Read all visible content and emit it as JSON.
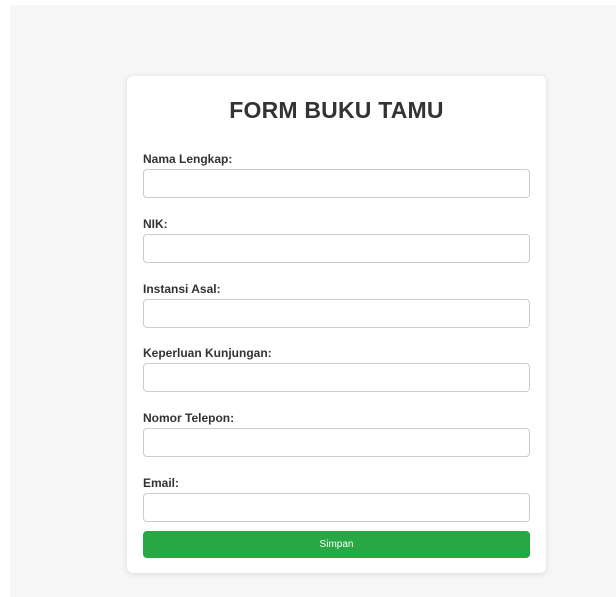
{
  "form": {
    "title": "FORM BUKU TAMU",
    "fields": [
      {
        "label": "Nama Lengkap:",
        "value": "",
        "placeholder": ""
      },
      {
        "label": "NIK:",
        "value": "",
        "placeholder": ""
      },
      {
        "label": "Instansi Asal:",
        "value": "",
        "placeholder": ""
      },
      {
        "label": "Keperluan Kunjungan:",
        "value": "",
        "placeholder": ""
      },
      {
        "label": "Nomor Telepon:",
        "value": "",
        "placeholder": ""
      },
      {
        "label": "Email:",
        "value": "",
        "placeholder": ""
      }
    ],
    "submit_label": "Simpan"
  },
  "colors": {
    "page_background": "#f6f6f6",
    "card_background": "#ffffff",
    "button_green": "#28a745",
    "text": "#333333",
    "input_border": "#cccccc"
  }
}
